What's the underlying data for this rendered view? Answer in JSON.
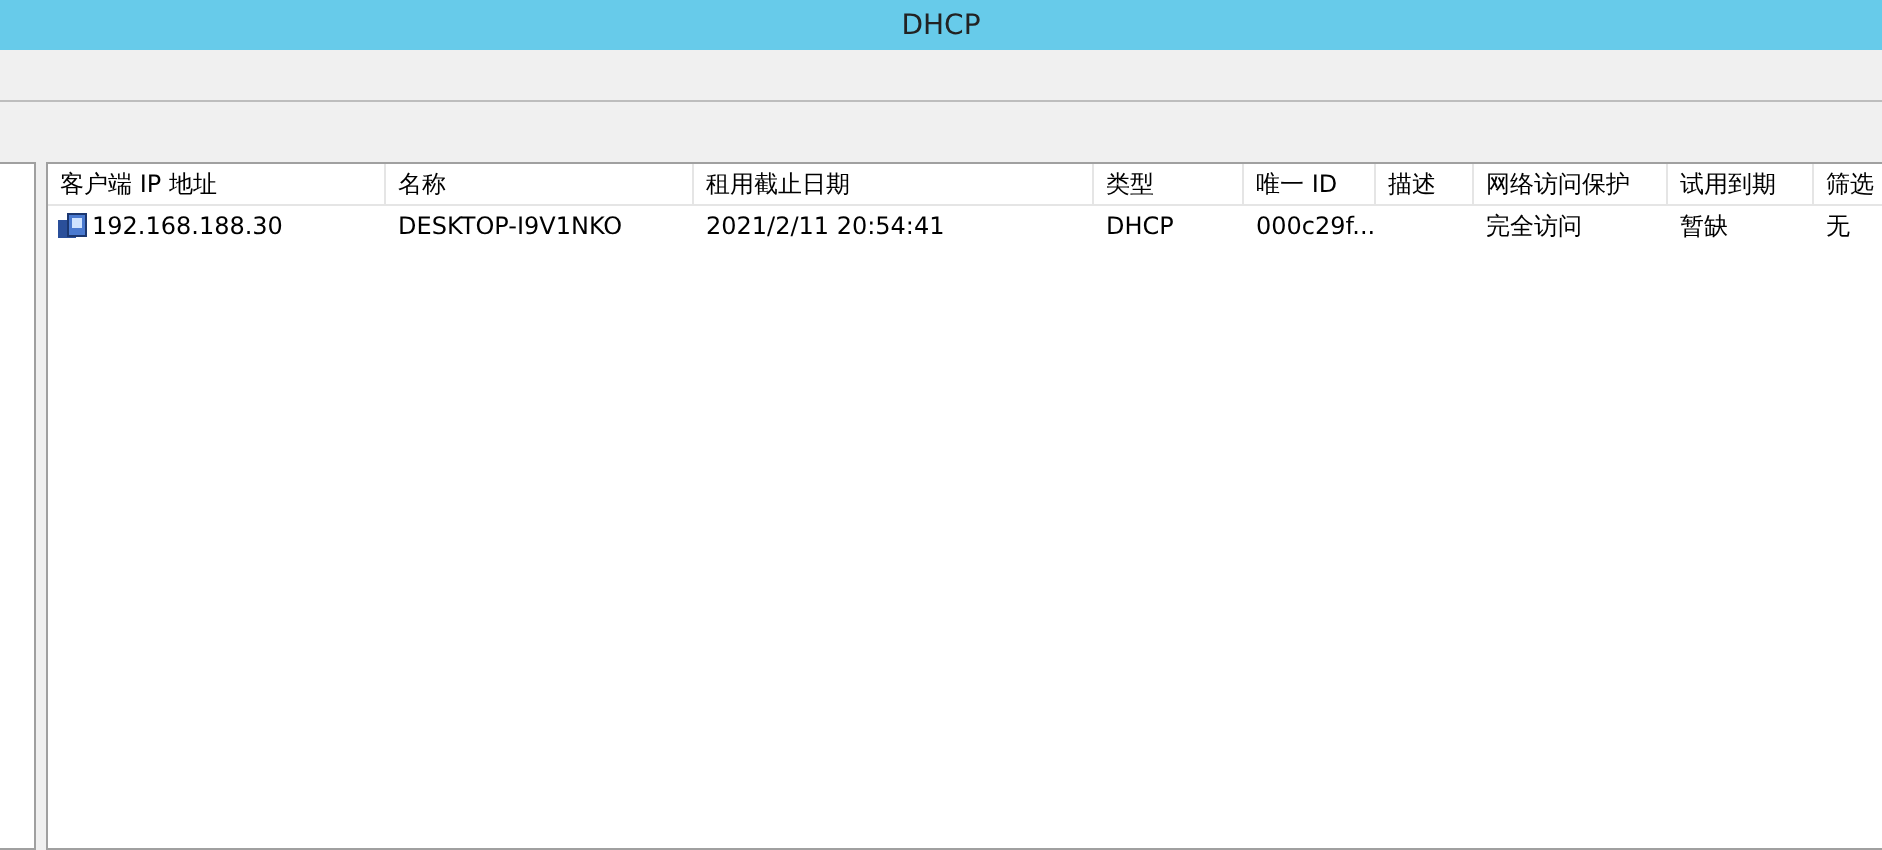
{
  "window": {
    "title": "DHCP"
  },
  "table": {
    "columns": [
      "客户端 IP 地址",
      "名称",
      "租用截止日期",
      "类型",
      "唯一 ID",
      "描述",
      "网络访问保护",
      "试用到期",
      "筛选"
    ],
    "rows": [
      {
        "cells": [
          "192.168.188.30",
          "DESKTOP-I9V1NKO",
          "2021/2/11 20:54:41",
          "DHCP",
          "000c29f...",
          "",
          "完全访问",
          "暂缺",
          "无"
        ],
        "selected": false
      }
    ]
  }
}
